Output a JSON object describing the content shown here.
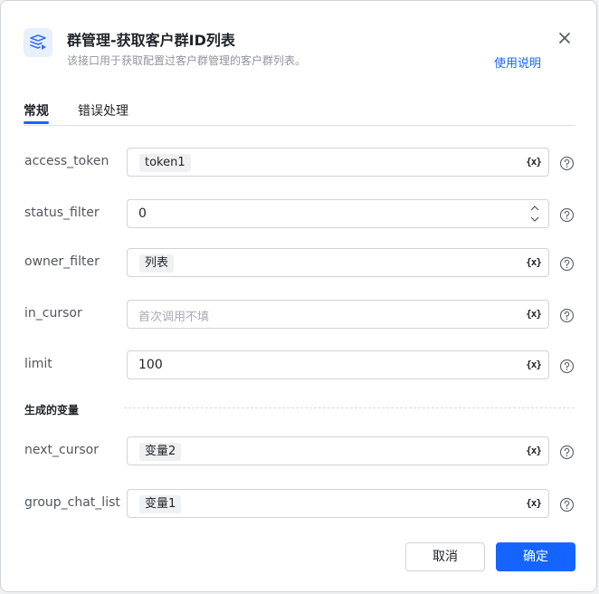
{
  "header": {
    "title": "群管理-获取客户群ID列表",
    "subtitle": "该接口用于获取配置过客户群管理的客户群列表。",
    "help_link": "使用说明"
  },
  "tabs": [
    {
      "label": "常规",
      "active": true
    },
    {
      "label": "错误处理",
      "active": false
    }
  ],
  "fields": {
    "access_token": {
      "label": "access_token",
      "tag": "token1"
    },
    "status_filter": {
      "label": "status_filter",
      "value": "0"
    },
    "owner_filter": {
      "label": "owner_filter",
      "tag": "列表"
    },
    "in_cursor": {
      "label": "in_cursor",
      "placeholder": "首次调用不填"
    },
    "limit": {
      "label": "limit",
      "value": "100"
    }
  },
  "output_section": {
    "title": "生成的变量",
    "next_cursor": {
      "label": "next_cursor",
      "tag": "变量2"
    },
    "group_chat_list": {
      "label": "group_chat_list",
      "tag": "变量1"
    }
  },
  "var_button": "{x}",
  "footer": {
    "cancel": "取消",
    "confirm": "确定"
  },
  "colors": {
    "accent": "#1664ff",
    "border": "#d0d3d8",
    "icon_bg": "#e8f0fd"
  },
  "icons": [
    "app-icon",
    "close-icon",
    "help-circle-icon",
    "stepper-icon"
  ]
}
